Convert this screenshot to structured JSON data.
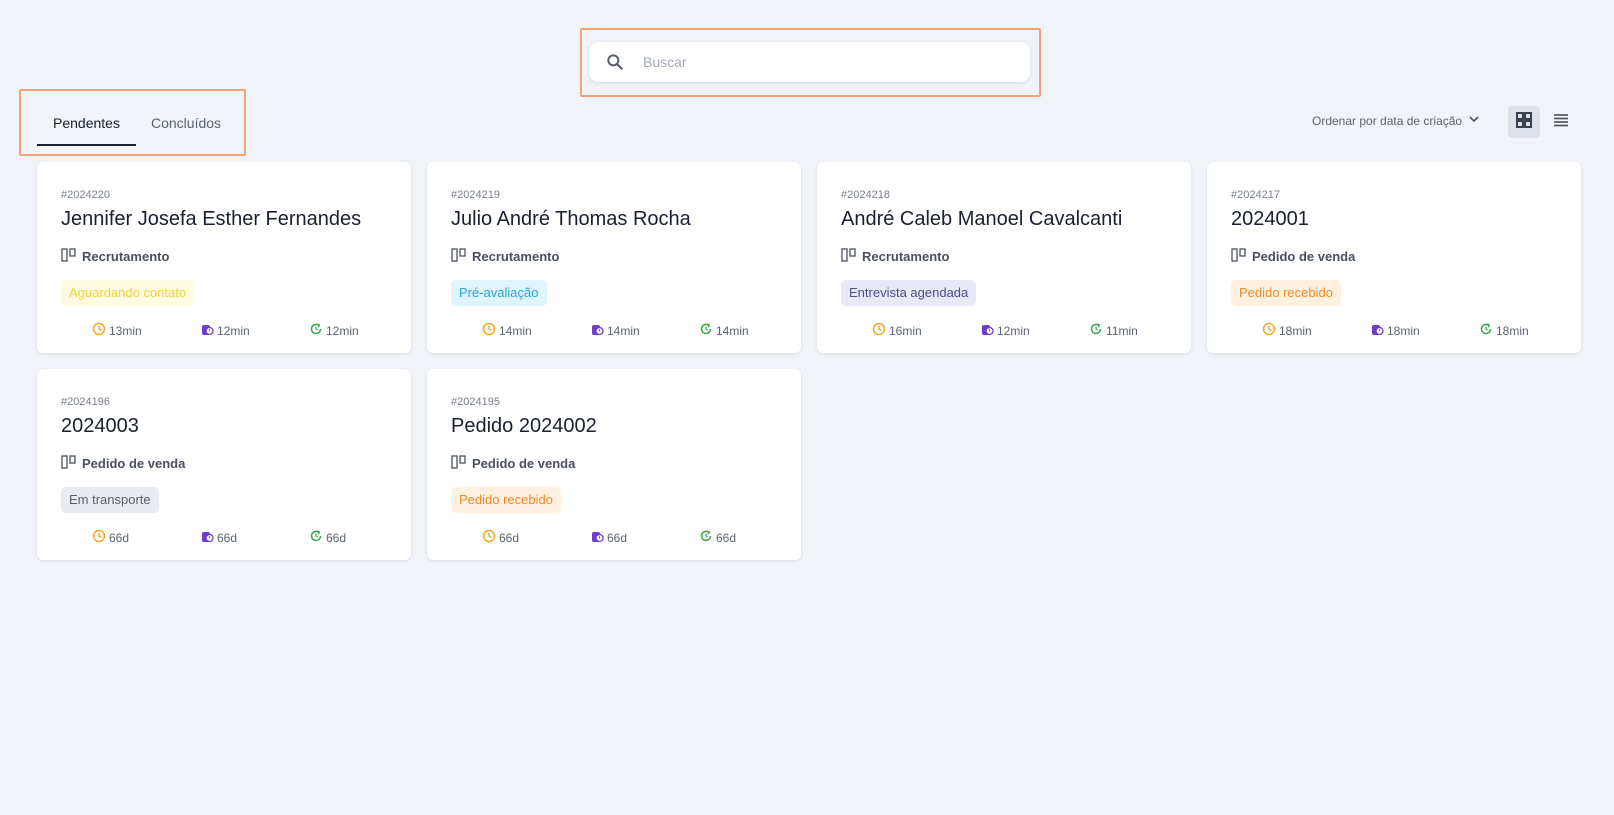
{
  "search": {
    "placeholder": "Buscar",
    "value": ""
  },
  "tabs": [
    {
      "label": "Pendentes",
      "active": true
    },
    {
      "label": "Concluídos",
      "active": false
    }
  ],
  "sort": {
    "label": "Ordenar por data de criação"
  },
  "view_modes": [
    "grid-icon",
    "list-icon"
  ],
  "colors": {
    "clock": "#f5a623",
    "stopwatch": "#6d3fc9",
    "refresh": "#3aa64c",
    "highlight": "#f2a37a"
  },
  "cards": [
    {
      "id": "#2024220",
      "title": "Jennifer Josefa Esther Fernandes",
      "type": "Recrutamento",
      "badge": "Aguardando contato",
      "metrics": [
        "13min",
        "12min",
        "12min"
      ]
    },
    {
      "id": "#2024219",
      "title": "Julio André Thomas Rocha",
      "type": "Recrutamento",
      "badge": "Pré-avaliação",
      "metrics": [
        "14min",
        "14min",
        "14min"
      ]
    },
    {
      "id": "#2024218",
      "title": "André Caleb Manoel Cavalcanti",
      "type": "Recrutamento",
      "badge": "Entrevista agendada",
      "metrics": [
        "16min",
        "12min",
        "11min"
      ]
    },
    {
      "id": "#2024217",
      "title": "2024001",
      "type": "Pedido de venda",
      "badge": "Pedido recebido",
      "metrics": [
        "18min",
        "18min",
        "18min"
      ]
    },
    {
      "id": "#2024196",
      "title": "2024003",
      "type": "Pedido de venda",
      "badge": "Em transporte",
      "metrics": [
        "66d",
        "66d",
        "66d"
      ]
    },
    {
      "id": "#2024195",
      "title": "Pedido 2024002",
      "type": "Pedido de venda",
      "badge": "Pedido recebido",
      "metrics": [
        "66d",
        "66d",
        "66d"
      ]
    }
  ]
}
